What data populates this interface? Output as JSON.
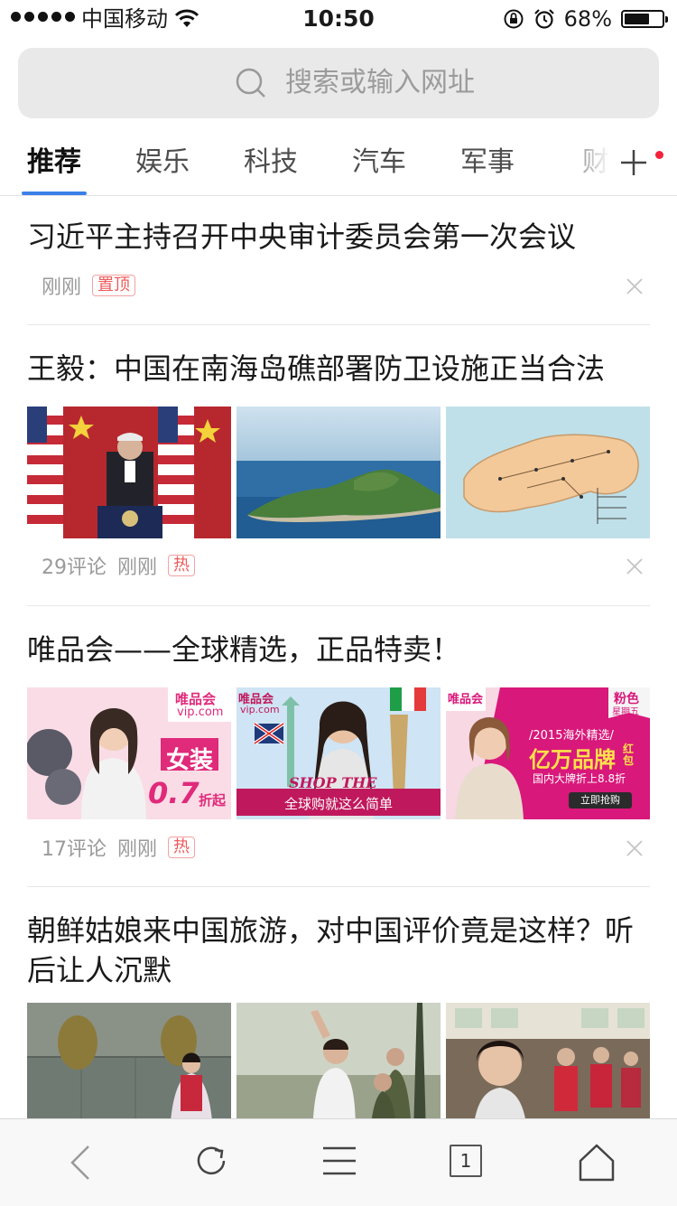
{
  "status_bar": {
    "carrier": "中国移动",
    "time": "10:50",
    "battery_percent": "68%",
    "battery_level": 0.68,
    "icons": [
      "signal-dots",
      "wifi-icon",
      "rotation-lock-icon",
      "alarm-icon",
      "battery-icon"
    ]
  },
  "search": {
    "placeholder": "搜索或输入网址",
    "icon": "search-icon"
  },
  "tabs": [
    {
      "label": "推荐",
      "active": true
    },
    {
      "label": "娱乐",
      "active": false
    },
    {
      "label": "科技",
      "active": false
    },
    {
      "label": "汽车",
      "active": false
    },
    {
      "label": "军事",
      "active": false
    },
    {
      "label": "财",
      "active": false
    }
  ],
  "colors": {
    "accent": "#3a80e8",
    "badge_red": "#ef5a5a",
    "notify_dot": "#f4213b"
  },
  "feed": [
    {
      "title": "习近平主持召开中央审计委员会第一次会议",
      "time": "刚刚",
      "tag": "置顶",
      "comments": "",
      "images": []
    },
    {
      "title": "王毅：中国在南海岛礁部署防卫设施正当合法",
      "comments": "29评论",
      "time": "刚刚",
      "tag": "热",
      "images": [
        "press-conference-photo",
        "island-aerial-photo",
        "island-map-image"
      ]
    },
    {
      "title": "唯品会——全球精选，正品特卖！",
      "comments": "17评论",
      "time": "刚刚",
      "tag": "热",
      "ad_texts": {
        "brand": "唯品会",
        "domain": "vip.com",
        "banner1_big": "女装",
        "banner1_num": "0.7",
        "banner1_suffix": "折起",
        "banner2_script": "SHOP THE WORLD",
        "banner2_bar": "全球购就这么简单",
        "banner3_top1": "粉色",
        "banner3_top2": "星期五",
        "banner3_line1": "/2015海外精选/",
        "banner3_big": "亿万品牌",
        "banner3_red": "红包",
        "banner3_line2": "国内大牌折上8.8折",
        "banner3_btn": "立即抢购"
      }
    },
    {
      "title": "朝鲜姑娘来中国旅游，对中国评价竟是这样？听后让人沉默",
      "images": [
        "woman-in-hanbok-photo",
        "tour-group-photo",
        "train-passengers-photo"
      ]
    }
  ],
  "toolbar": {
    "tab_count": "1",
    "buttons": [
      "back-icon",
      "refresh-icon",
      "menu-icon",
      "tabs-icon",
      "home-icon"
    ]
  }
}
